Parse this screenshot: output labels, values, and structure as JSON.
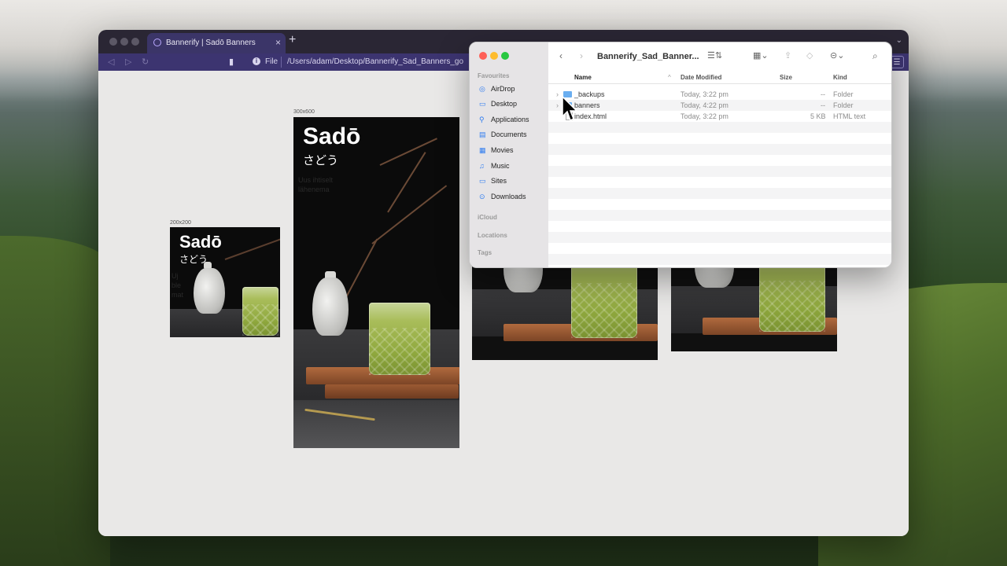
{
  "browser": {
    "tab_title": "Bannerify | Sadō Banners",
    "tab_close": "×",
    "new_tab": "+",
    "tab_menu": "⌄",
    "url_scheme": "File",
    "url_path": "/Users/adam/Desktop/Bannerify_Sad_Banners_go",
    "menu_icon": "☰"
  },
  "banners": [
    {
      "size_label": "200x200",
      "title": "Sadō",
      "subtitle": "さどう",
      "faint": "Uj\nble\nmat"
    },
    {
      "size_label": "300x600",
      "title": "Sadō",
      "subtitle": "さどう",
      "faint": "Uus ihtiselt\nlähenema"
    }
  ],
  "finder": {
    "title": "Bannerify_Sad_Banner...",
    "sidebar": {
      "favourites_header": "Favourites",
      "items": [
        {
          "label": "AirDrop",
          "icon": "airdrop-icon",
          "glyph": "◎"
        },
        {
          "label": "Desktop",
          "icon": "desktop-icon",
          "glyph": "▭"
        },
        {
          "label": "Applications",
          "icon": "applications-icon",
          "glyph": "⚲"
        },
        {
          "label": "Documents",
          "icon": "document-icon",
          "glyph": "▤"
        },
        {
          "label": "Movies",
          "icon": "movies-icon",
          "glyph": "▦"
        },
        {
          "label": "Music",
          "icon": "music-icon",
          "glyph": "♫"
        },
        {
          "label": "Sites",
          "icon": "folder-icon",
          "glyph": "▭"
        },
        {
          "label": "Downloads",
          "icon": "downloads-icon",
          "glyph": "⊙"
        }
      ],
      "icloud_header": "iCloud",
      "locations_header": "Locations",
      "tags_header": "Tags"
    },
    "columns": {
      "name": "Name",
      "date": "Date Modified",
      "size": "Size",
      "kind": "Kind"
    },
    "rows": [
      {
        "name": "_backups",
        "date": "Today, 3:22 pm",
        "size": "--",
        "kind": "Folder"
      },
      {
        "name": "banners",
        "date": "Today, 4:22 pm",
        "size": "--",
        "kind": "Folder"
      },
      {
        "name": "index.html",
        "date": "Today, 3:22 pm",
        "size": "5 KB",
        "kind": "HTML text"
      }
    ]
  }
}
